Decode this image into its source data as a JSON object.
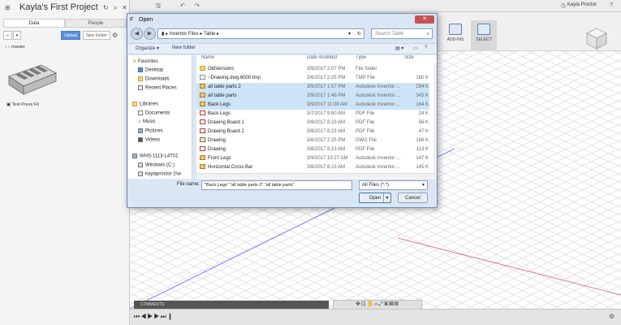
{
  "left_panel": {
    "title": "Kayla's First Project",
    "tabs": [
      "Data",
      "People"
    ],
    "upload_label": "Upload",
    "new_folder_label": "New Folder",
    "branch": "master",
    "design_name": "Test Press Fit"
  },
  "app_bar": {
    "user_name": "Kayla Proctor",
    "help_icon": "help-icon"
  },
  "ribbon": {
    "addins_label": "ADD-INS",
    "select_label": "SELECT"
  },
  "dialog": {
    "title": "Open",
    "path": [
      "Inventor Files",
      "Table"
    ],
    "search_placeholder": "Search Table",
    "organize_label": "Organize",
    "new_folder_label": "New folder",
    "nav_pane": {
      "favorites": "Favorites",
      "favorites_items": [
        "Desktop",
        "Downloads",
        "Recent Places"
      ],
      "libraries": "Libraries",
      "libraries_items": [
        "Documents",
        "Music",
        "Pictures",
        "Videos"
      ],
      "computer": "WHS-1113-L4T01",
      "computer_items": [
        "Windows (C:)",
        "kaylaproctor (\\\\w"
      ]
    },
    "columns": [
      "Name",
      "Date modified",
      "Type",
      "Size"
    ],
    "files": [
      {
        "name": "OldVersions",
        "date": "3/9/2017 2:07 PM",
        "type": "File folder",
        "size": "",
        "icon": "folder",
        "selected": false
      },
      {
        "name": "~Drawing.dwg.6000.tmp",
        "date": "3/6/2017 2:25 PM",
        "type": "TMP File",
        "size": "180 K",
        "icon": "tmp",
        "selected": false
      },
      {
        "name": "all table parts 2",
        "date": "3/9/2017 1:57 PM",
        "type": "Autodesk Inventor ...",
        "size": "294 K",
        "icon": "ipt",
        "selected": true
      },
      {
        "name": "all table parts",
        "date": "3/9/2017 1:46 PM",
        "type": "Autodesk Inventor ...",
        "size": "345 K",
        "icon": "ipt",
        "selected": true
      },
      {
        "name": "Back Legs",
        "date": "3/9/2017 11:09 AM",
        "type": "Autodesk Inventor ...",
        "size": "164 K",
        "icon": "ipt",
        "selected": true
      },
      {
        "name": "Back Legs",
        "date": "3/7/2017 9:50 AM",
        "type": "PDF File",
        "size": "24 K",
        "icon": "pdf",
        "selected": false
      },
      {
        "name": "Drawing Board 1",
        "date": "3/8/2017 8:23 AM",
        "type": "PDF File",
        "size": "56 K",
        "icon": "pdf",
        "selected": false
      },
      {
        "name": "Drawing Board 2",
        "date": "3/8/2017 8:23 AM",
        "type": "PDF File",
        "size": "47 K",
        "icon": "pdf",
        "selected": false
      },
      {
        "name": "Drawing",
        "date": "3/6/2017 2:25 PM",
        "type": "DWG File",
        "size": "168 K",
        "icon": "dwg",
        "selected": false
      },
      {
        "name": "Drawing",
        "date": "3/8/2017 8:23 AM",
        "type": "PDF File",
        "size": "113 K",
        "icon": "pdf",
        "selected": false
      },
      {
        "name": "Front Legs",
        "date": "3/9/2017 10:27 AM",
        "type": "Autodesk Inventor ...",
        "size": "147 K",
        "icon": "ipt",
        "selected": false
      },
      {
        "name": "Horizontal Cross Bar",
        "date": "3/8/2017 8:23 AM",
        "type": "Autodesk Inventor ...",
        "size": "145 K",
        "icon": "ipt",
        "selected": false
      }
    ],
    "file_name_label": "File name:",
    "file_name_value": "\"Back Legs\" \"all table parts 2\" \"all table parts\"",
    "file_type_value": "All Files (*.*)",
    "open_label": "Open",
    "cancel_label": "Cancel"
  },
  "comments_label": "COMMENTS"
}
